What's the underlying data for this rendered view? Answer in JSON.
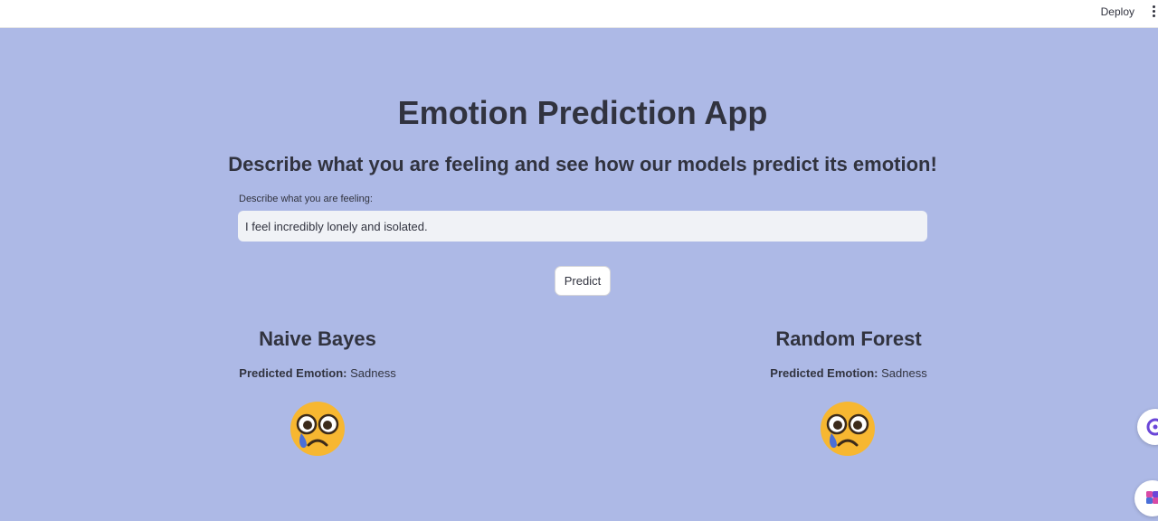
{
  "topbar": {
    "deploy_label": "Deploy",
    "menu_icon": "kebab-menu-icon"
  },
  "header": {
    "title": "Emotion Prediction App",
    "subtitle": "Describe what you are feeling and see how our models predict its emotion!"
  },
  "form": {
    "input_label": "Describe what you are feeling:",
    "input_value": "I feel incredibly lonely and isolated.",
    "button_label": "Predict"
  },
  "results": [
    {
      "model": "Naive Bayes",
      "prediction_label": "Predicted Emotion:",
      "prediction_value": "Sadness",
      "emoji": "sad-tearful-face-icon"
    },
    {
      "model": "Random Forest",
      "prediction_label": "Predicted Emotion:",
      "prediction_value": "Sadness",
      "emoji": "sad-tearful-face-icon"
    }
  ],
  "colors": {
    "background": "#adb9e6",
    "text": "#31333f",
    "input_bg": "#f0f2f6",
    "emoji_face": "#f7b731",
    "emoji_tear": "#4a6fd8"
  }
}
